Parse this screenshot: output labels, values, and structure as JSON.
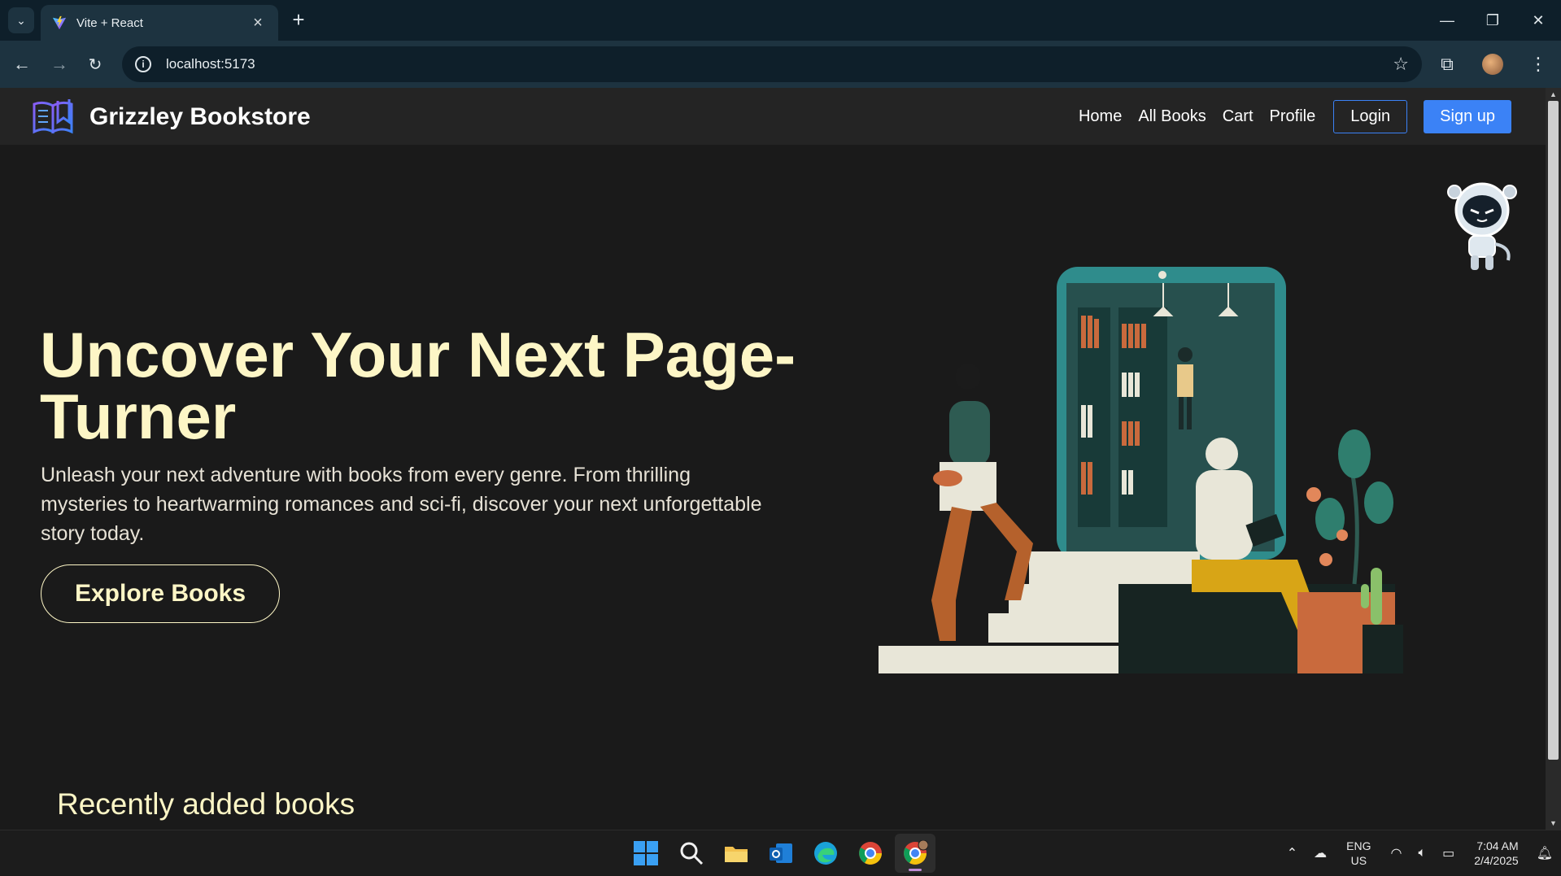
{
  "browser": {
    "tab_title": "Vite + React",
    "url": "localhost:5173"
  },
  "site": {
    "brand": "Grizzley Bookstore",
    "nav": {
      "home": "Home",
      "all_books": "All Books",
      "cart": "Cart",
      "profile": "Profile",
      "login": "Login",
      "signup": "Sign up"
    }
  },
  "hero": {
    "title": "Uncover Your Next Page-Turner",
    "text": "Unleash your next adventure with books from every genre. From thrilling mysteries to heartwarming romances and sci-fi, discover your next unforgettable story today.",
    "cta": "Explore Books"
  },
  "sections": {
    "recent_title": "Recently added books"
  },
  "taskbar": {
    "lang_line1": "ENG",
    "lang_line2": "US",
    "time": "7:04 AM",
    "date": "2/4/2025"
  },
  "colors": {
    "accent": "#3b82f6",
    "hero_text": "#fdf6c6",
    "background": "#1a1a1a"
  }
}
